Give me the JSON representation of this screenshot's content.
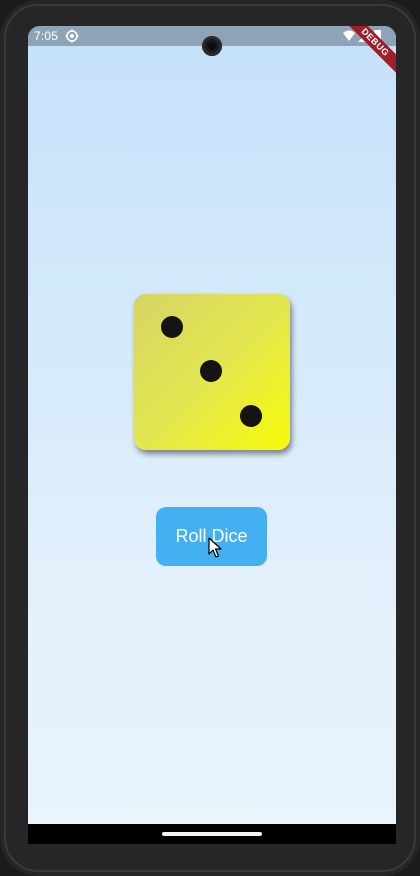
{
  "status_bar": {
    "time": "7:05",
    "icons": [
      "settings-gear-icon",
      "wifi-icon",
      "signal-icon",
      "battery-icon"
    ]
  },
  "debug_banner": {
    "label": "DEBUG"
  },
  "dice": {
    "face_value": 3,
    "colors": {
      "top_left": "#d6d566",
      "bottom_right": "#f8fb08",
      "pip": "#141414"
    }
  },
  "roll_button": {
    "label": "Roll Dice",
    "color": "#43b0f1"
  },
  "background": {
    "gradient_top": "#c5e1fb",
    "gradient_bottom": "#e9f4fb"
  }
}
